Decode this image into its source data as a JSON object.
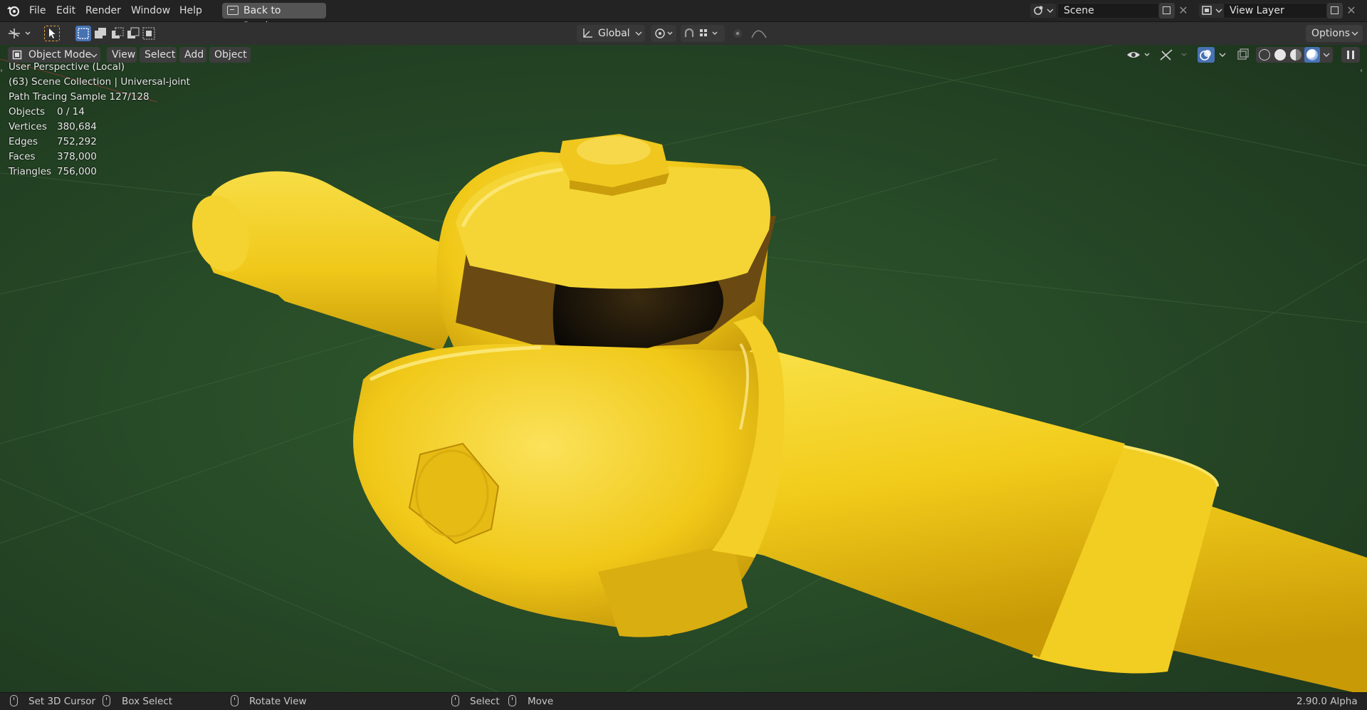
{
  "menu": {
    "items": [
      "File",
      "Edit",
      "Render",
      "Window",
      "Help"
    ],
    "back_button": "Back to Previous"
  },
  "scene": {
    "value": "Scene"
  },
  "view_layer": {
    "value": "View Layer"
  },
  "toolbar": {
    "transform_orientation": "Global",
    "options_label": "Options"
  },
  "viewport_header": {
    "mode": "Object Mode",
    "menus": [
      "View",
      "Select",
      "Add",
      "Object"
    ]
  },
  "overlay": {
    "perspective": "User Perspective (Local)",
    "collection": "(63) Scene Collection | Universal-joint",
    "sample": "Path Tracing Sample 127/128",
    "stats": [
      {
        "label": "Objects",
        "value": "0 / 14"
      },
      {
        "label": "Vertices",
        "value": "380,684"
      },
      {
        "label": "Edges",
        "value": "752,292"
      },
      {
        "label": "Faces",
        "value": "378,000"
      },
      {
        "label": "Triangles",
        "value": "756,000"
      }
    ]
  },
  "statusbar": {
    "set_cursor": "Set 3D Cursor",
    "box_select": "Box Select",
    "rotate_view": "Rotate View",
    "select": "Select",
    "move": "Move",
    "version": "2.90.0 Alpha"
  },
  "colors": {
    "viewport_bg": "#2a4d29",
    "object": "#f2cf22",
    "accent_blue": "#4772b3",
    "header_bg": "#303030"
  }
}
